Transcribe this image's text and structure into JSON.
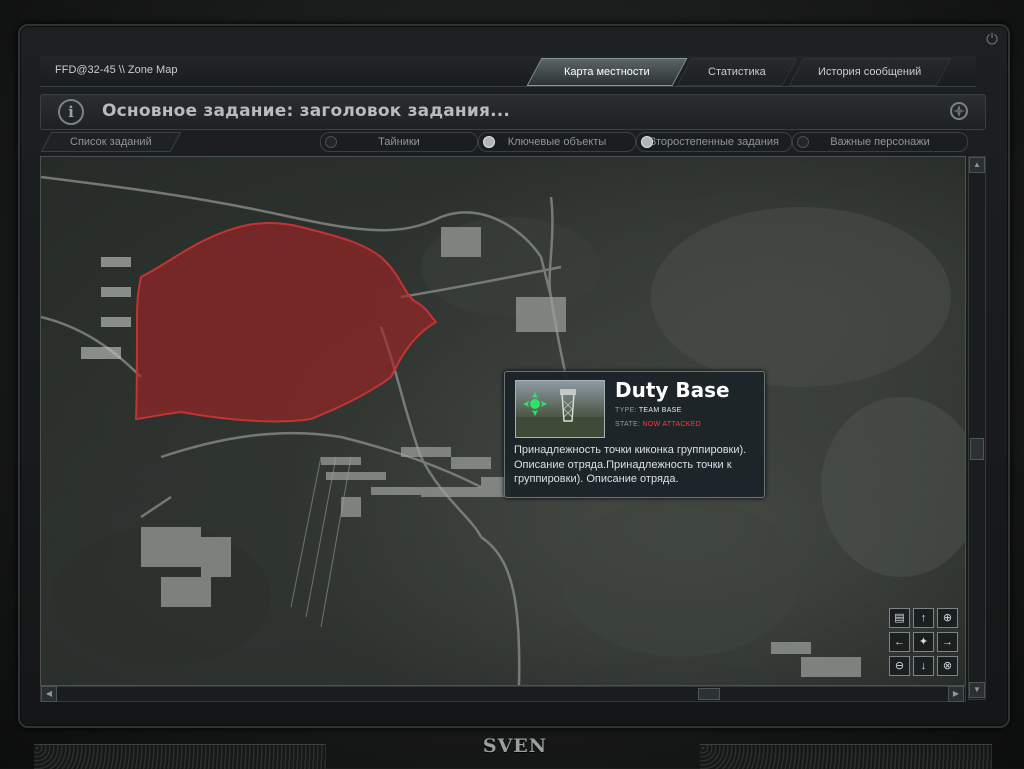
{
  "window": {
    "title": "FFD@32-45 \\\\ Zone Map"
  },
  "tabs": [
    {
      "label": "Карта местности",
      "active": true
    },
    {
      "label": "Статистика",
      "active": false
    },
    {
      "label": "История сообщений",
      "active": false
    }
  ],
  "task": {
    "title": "Основное задание: заголовок задания..."
  },
  "filters": {
    "task_list": "Список заданий",
    "items": [
      {
        "label": "Тайники",
        "checked": false
      },
      {
        "label": "Ключевые объекты",
        "checked": true
      },
      {
        "label": "Второстепенные задания",
        "checked": true
      },
      {
        "label": "Важные персонажи",
        "checked": false
      }
    ]
  },
  "popup": {
    "title": "Duty Base",
    "type_label": "TYPE:",
    "type_value": "TEAM BASE",
    "state_label": "STATE:",
    "state_value": "NOW ATTACKED",
    "description": "Принадлежность точки киконка группировки). Описание отряда.Принадлежность точки к группировки). Описание отряда."
  },
  "navpad": {
    "icons": [
      "document-icon",
      "arrow-up-icon",
      "zoom-in-icon",
      "arrow-left-icon",
      "player-center-icon",
      "arrow-right-icon",
      "zoom-out-icon",
      "arrow-down-icon",
      "zoom-reset-icon"
    ]
  },
  "footer": {
    "brand": "SVEN"
  },
  "colors": {
    "zone_highlight": "#a32424",
    "alert": "#ff3b3b",
    "marker": "#2fe06a"
  }
}
